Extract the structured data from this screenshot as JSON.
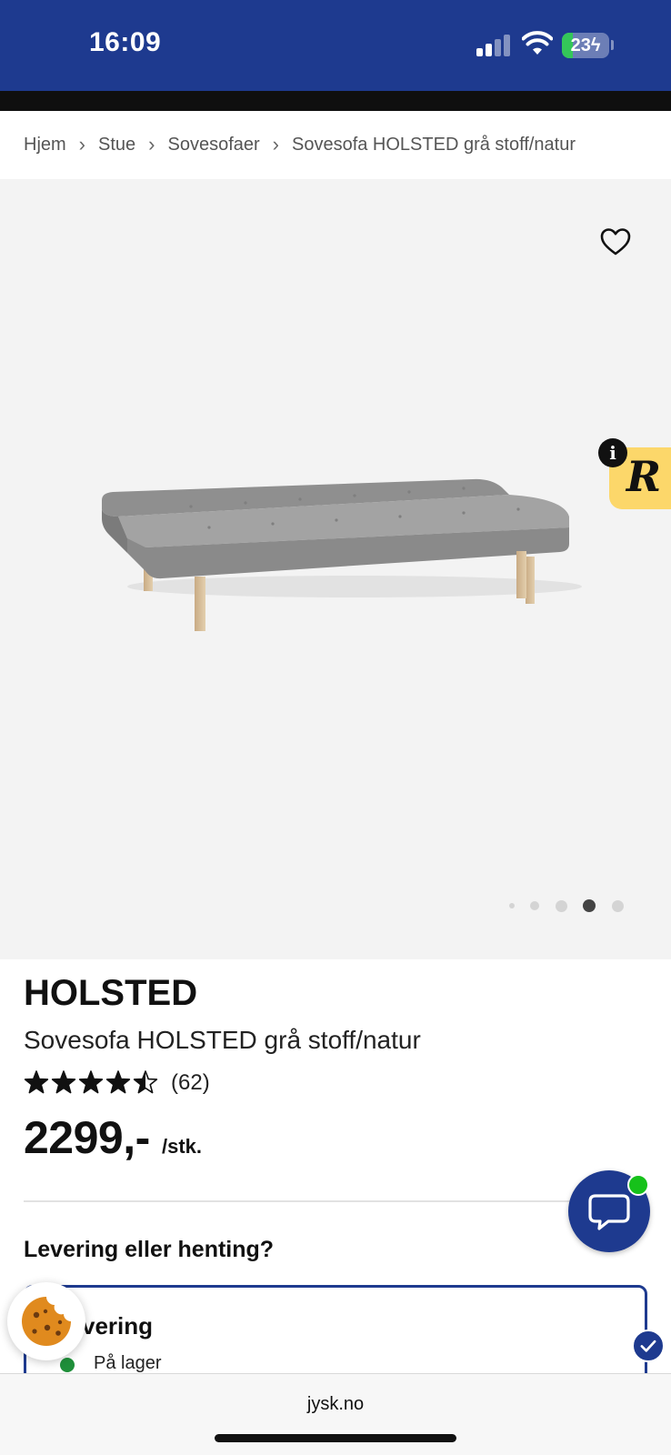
{
  "status_bar": {
    "time": "16:09",
    "battery_level": "23",
    "battery_fraction": 0.23,
    "signal_icon": "cellular-signal-icon",
    "wifi_icon": "wifi-icon",
    "charging_icon": "bolt-icon",
    "background_color": "#1e3a8f"
  },
  "breadcrumb": {
    "items": [
      "Hjem",
      "Stue",
      "Sovesofaer",
      "Sovesofa HOLSTED grå stoff/natur"
    ],
    "separator": "›"
  },
  "gallery": {
    "favorite_icon": "heart-outline-icon",
    "image_subject": "grey-sofa-bed",
    "dot_count": 5,
    "active_dot": 4,
    "widget": {
      "letter": "R",
      "info_label": "i",
      "color": "#fcd76a"
    }
  },
  "product": {
    "brand": "HOLSTED",
    "name": "Sovesofa HOLSTED grå stoff/natur",
    "rating_value": 4.5,
    "rating_max": 5,
    "review_count": "(62)",
    "price": "2299,-",
    "unit": "/stk."
  },
  "delivery": {
    "heading": "Levering eller henting?",
    "selected_option_label": "vering",
    "stock_status": "På lager",
    "stock_color": "#1f8f3a",
    "selected": true
  },
  "chat": {
    "icon": "chat-bubble-icon",
    "online_color": "#16c11a"
  },
  "cookie": {
    "icon": "cookie-icon"
  },
  "browser": {
    "url": "jysk.no"
  },
  "colors": {
    "brand_blue": "#1e3a8f",
    "gallery_bg": "#f3f3f3"
  }
}
